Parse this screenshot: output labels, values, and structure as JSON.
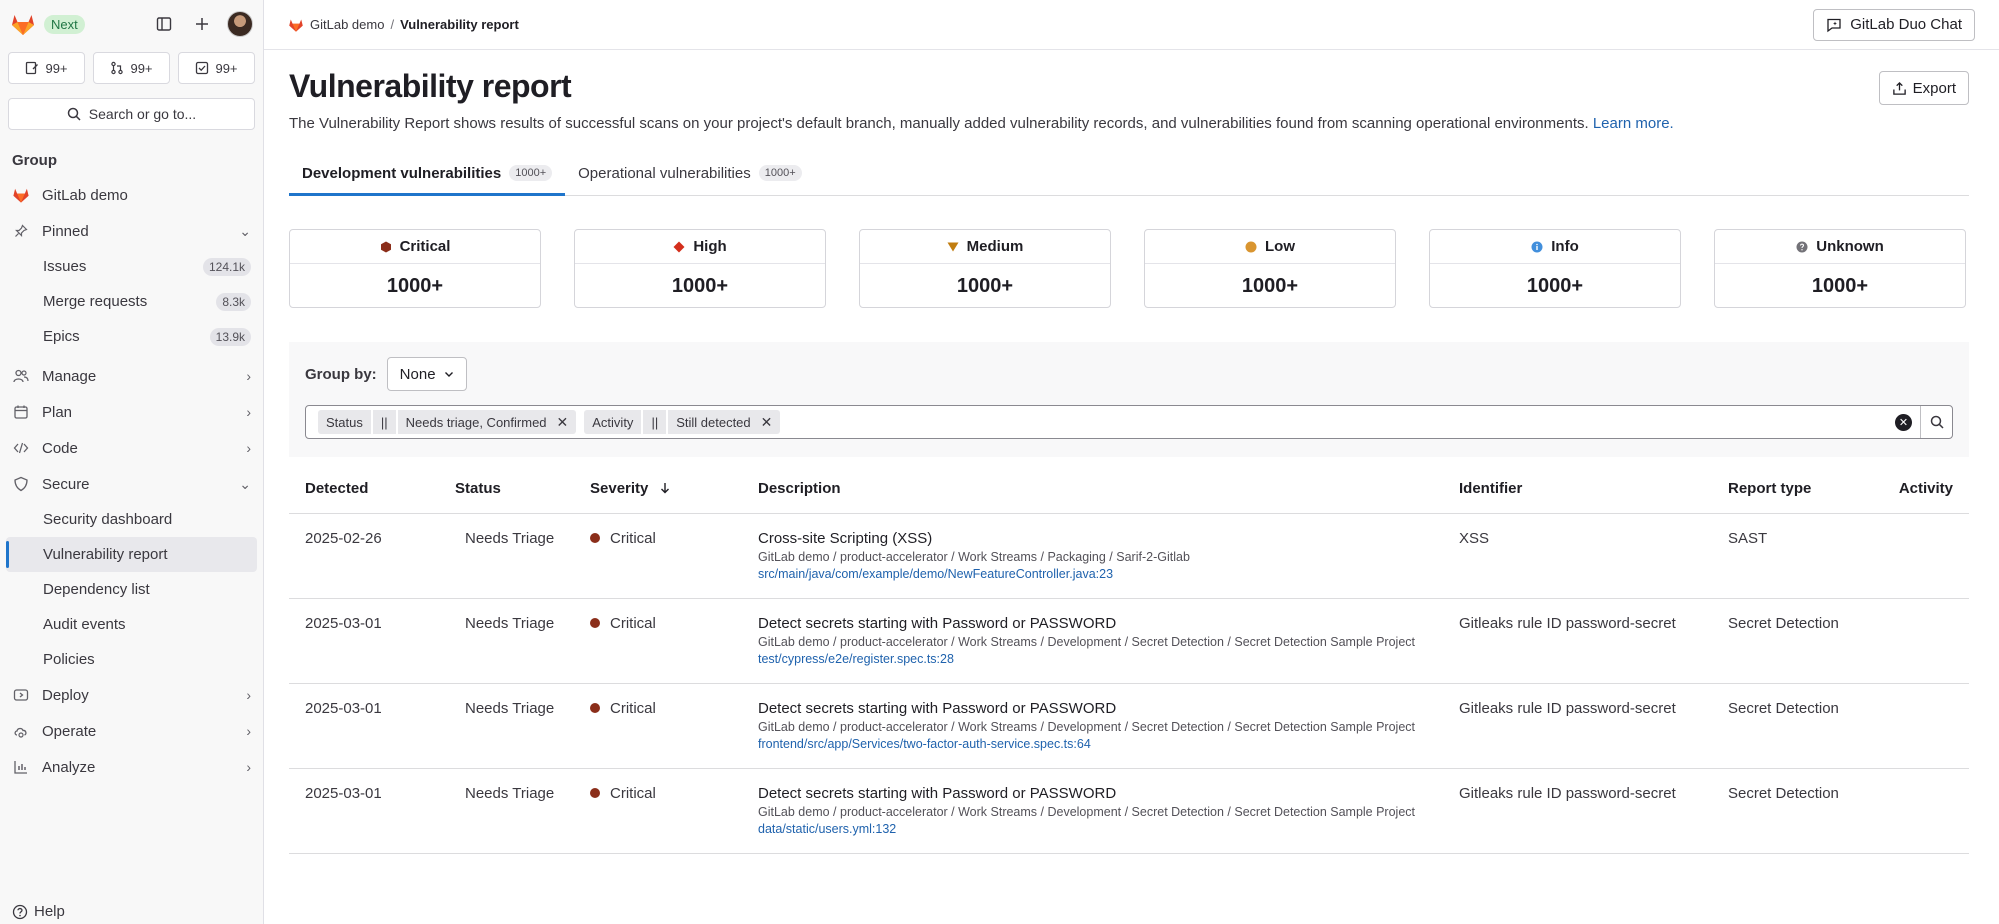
{
  "sidebar": {
    "badge": "Next",
    "counters": [
      "99+",
      "99+",
      "99+"
    ],
    "search_label": "Search or go to...",
    "section_title": "Group",
    "group_name": "GitLab demo",
    "pinned_label": "Pinned",
    "pinned_items": [
      {
        "label": "Issues",
        "count": "124.1k"
      },
      {
        "label": "Merge requests",
        "count": "8.3k"
      },
      {
        "label": "Epics",
        "count": "13.9k"
      }
    ],
    "nav_before": [
      {
        "label": "Manage"
      },
      {
        "label": "Plan"
      },
      {
        "label": "Code"
      }
    ],
    "secure_label": "Secure",
    "secure_items": [
      "Security dashboard",
      "Vulnerability report",
      "Dependency list",
      "Audit events",
      "Policies"
    ],
    "nav_after": [
      {
        "label": "Deploy"
      },
      {
        "label": "Operate"
      },
      {
        "label": "Analyze"
      }
    ],
    "help_label": "Help"
  },
  "topbar": {
    "breadcrumb_group": "GitLab demo",
    "breadcrumb_current": "Vulnerability report",
    "duo_label": "GitLab Duo Chat"
  },
  "page": {
    "title": "Vulnerability report",
    "export_label": "Export",
    "description": "The Vulnerability Report shows results of successful scans on your project's default branch, manually added vulnerability records, and vulnerabilities found from scanning operational environments.",
    "learn_more": "Learn more."
  },
  "tabs": [
    {
      "label": "Development vulnerabilities",
      "count": "1000+"
    },
    {
      "label": "Operational vulnerabilities",
      "count": "1000+"
    }
  ],
  "severity_cards": [
    {
      "label": "Critical",
      "value": "1000+",
      "color": "#8b2e1a"
    },
    {
      "label": "High",
      "value": "1000+",
      "color": "#d42f1c"
    },
    {
      "label": "Medium",
      "value": "1000+",
      "color": "#c17d10"
    },
    {
      "label": "Low",
      "value": "1000+",
      "color": "#d99530"
    },
    {
      "label": "Info",
      "value": "1000+",
      "color": "#428fdc"
    },
    {
      "label": "Unknown",
      "value": "1000+",
      "color": "#737278"
    }
  ],
  "filters": {
    "group_by_label": "Group by:",
    "group_by_value": "None",
    "tokens": [
      {
        "key": "Status",
        "op": "||",
        "value": "Needs triage, Confirmed"
      },
      {
        "key": "Activity",
        "op": "||",
        "value": "Still detected"
      }
    ]
  },
  "table": {
    "headers": [
      "Detected",
      "Status",
      "Severity",
      "Description",
      "Identifier",
      "Report type",
      "Activity"
    ],
    "rows": [
      {
        "detected": "2025-02-26",
        "status": "Needs Triage",
        "severity": "Critical",
        "title": "Cross-site Scripting (XSS)",
        "path": "GitLab demo / product-accelerator / Work Streams / Packaging / Sarif-2-Gitlab",
        "file": "src/main/java/com/example/demo/NewFeatureController.java:23",
        "identifier": "XSS",
        "report_type": "SAST"
      },
      {
        "detected": "2025-03-01",
        "status": "Needs Triage",
        "severity": "Critical",
        "title": "Detect secrets starting with Password or PASSWORD",
        "path": "GitLab demo / product-accelerator / Work Streams / Development / Secret Detection / Secret Detection Sample Project",
        "file": "test/cypress/e2e/register.spec.ts:28",
        "identifier": "Gitleaks rule ID password-secret",
        "report_type": "Secret Detection"
      },
      {
        "detected": "2025-03-01",
        "status": "Needs Triage",
        "severity": "Critical",
        "title": "Detect secrets starting with Password or PASSWORD",
        "path": "GitLab demo / product-accelerator / Work Streams / Development / Secret Detection / Secret Detection Sample Project",
        "file": "frontend/src/app/Services/two-factor-auth-service.spec.ts:64",
        "identifier": "Gitleaks rule ID password-secret",
        "report_type": "Secret Detection"
      },
      {
        "detected": "2025-03-01",
        "status": "Needs Triage",
        "severity": "Critical",
        "title": "Detect secrets starting with Password or PASSWORD",
        "path": "GitLab demo / product-accelerator / Work Streams / Development / Secret Detection / Secret Detection Sample Project",
        "file": "data/static/users.yml:132",
        "identifier": "Gitleaks rule ID password-secret",
        "report_type": "Secret Detection"
      }
    ]
  }
}
